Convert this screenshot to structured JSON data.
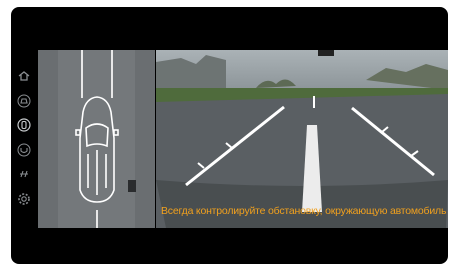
{
  "warning_text": "Всегда контролируйте обстановку, окружающую автомобиль",
  "rail_icons": [
    "home-icon",
    "front-camera-icon",
    "top-view-icon",
    "rear-camera-icon",
    "parking-sensor-icon",
    "settings-icon"
  ],
  "colors": {
    "warning": "#f0a01e",
    "screen_bg": "#000000",
    "lane_marking": "#ffffff"
  }
}
